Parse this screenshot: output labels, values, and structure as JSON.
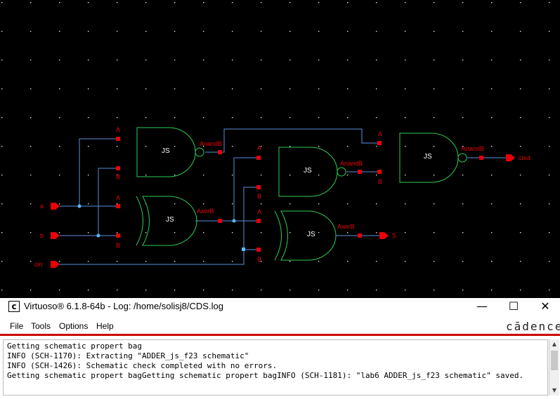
{
  "window": {
    "title": "Virtuoso® 6.1.8-64b - Log: /home/solisj8/CDS.log",
    "app_icon_glyph": "[c]",
    "minimize_glyph": "—",
    "maximize_glyph": "☐",
    "close_glyph": "✕"
  },
  "menu": [
    "File",
    "Tools",
    "Options",
    "Help"
  ],
  "brand": "cādence",
  "log_lines": [
    "Getting schematic propert bag",
    "INFO (SCH-1170): Extracting \"ADDER_js_f23 schematic\"",
    "INFO (SCH-1426): Schematic check completed with no errors.",
    "Getting schematic propert bagGetting schematic propert bagINFO (SCH-1181): \"lab6 ADDER_js_f23 schematic\" saved."
  ],
  "schematic": {
    "pins": {
      "a": "a",
      "b": "b",
      "cin": "cin",
      "cout": "cout",
      "s": "S"
    },
    "gate_label": "JS",
    "port_a": "A",
    "port_b": "B",
    "nand_out": "AnandB",
    "xor_out": "AxorB",
    "colors": {
      "wire": "#5b8fd8",
      "gate": "#2ecc52",
      "pin": "#e8000a",
      "label": "#e8000a",
      "bg": "#000000",
      "grid": "#ffffff"
    }
  }
}
